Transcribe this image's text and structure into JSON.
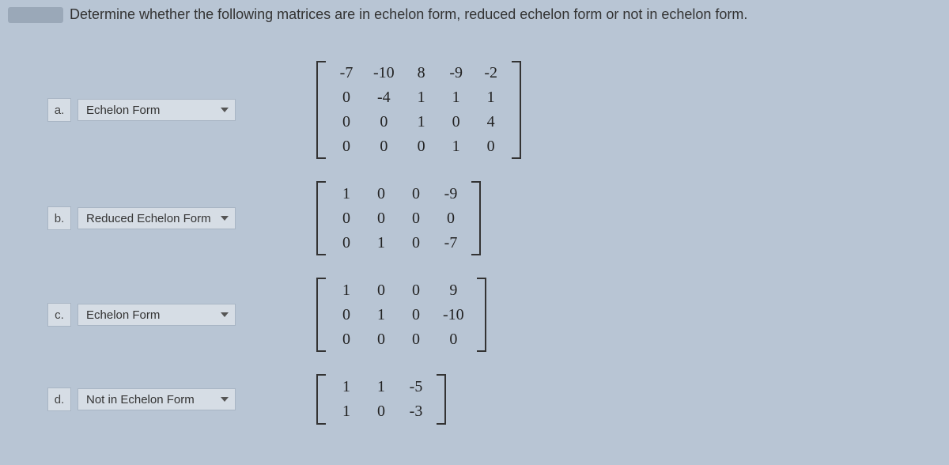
{
  "question": "Determine whether the following matrices are in echelon form, reduced echelon form or not in echelon form.",
  "items": [
    {
      "letter": "a.",
      "selected": "Echelon Form",
      "matrix": [
        [
          "-7",
          "-10",
          "8",
          "-9",
          "-2"
        ],
        [
          "0",
          "-4",
          "1",
          "1",
          "1"
        ],
        [
          "0",
          "0",
          "1",
          "0",
          "4"
        ],
        [
          "0",
          "0",
          "0",
          "1",
          "0"
        ]
      ]
    },
    {
      "letter": "b.",
      "selected": "Reduced Echelon Form",
      "matrix": [
        [
          "1",
          "0",
          "0",
          "-9"
        ],
        [
          "0",
          "0",
          "0",
          "0"
        ],
        [
          "0",
          "1",
          "0",
          "-7"
        ]
      ]
    },
    {
      "letter": "c.",
      "selected": "Echelon Form",
      "matrix": [
        [
          "1",
          "0",
          "0",
          "9"
        ],
        [
          "0",
          "1",
          "0",
          "-10"
        ],
        [
          "0",
          "0",
          "0",
          "0"
        ]
      ]
    },
    {
      "letter": "d.",
      "selected": "Not in Echelon Form",
      "matrix": [
        [
          "1",
          "1",
          "-5"
        ],
        [
          "1",
          "0",
          "-3"
        ]
      ]
    }
  ]
}
